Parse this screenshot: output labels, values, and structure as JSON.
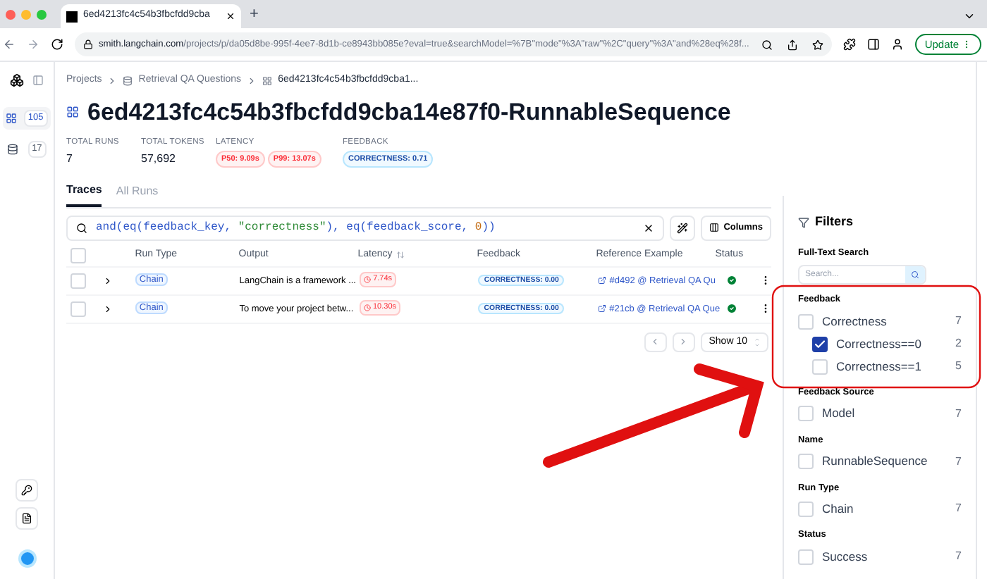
{
  "browser": {
    "tab_title": "6ed4213fc4c54b3fbcfdd9cba",
    "new_tab": "+",
    "url_host": "smith.langchain.com",
    "url_path": "/projects/p/da05d8be-995f-4ee7-8d1b-ce8943bb085e?eval=true&searchModel=%7B\"mode\"%3A\"raw\"%2C\"query\"%3A\"and%28eq%28f...",
    "update_button": "Update"
  },
  "sidebar": {
    "items": [
      {
        "kind": "grid",
        "count": "105",
        "selected": true
      },
      {
        "kind": "database",
        "count": "17",
        "selected": false
      }
    ]
  },
  "breadcrumbs": [
    "Projects",
    "Retrieval QA Questions",
    "6ed4213fc4c54b3fbcfdd9cba1..."
  ],
  "title": "6ed4213fc4c54b3fbcfdd9cba14e87f0-RunnableSequence",
  "stats": [
    {
      "label": "TOTAL RUNS",
      "kind": "value",
      "value": "7"
    },
    {
      "label": "TOTAL TOKENS",
      "kind": "value",
      "value": "57,692"
    },
    {
      "label": "LATENCY",
      "kind": "danger",
      "badges": [
        "P50: 9.09s",
        "P99: 13.07s"
      ]
    },
    {
      "label": "FEEDBACK",
      "kind": "info",
      "badges": [
        "CORRECTNESS: 0.71"
      ]
    }
  ],
  "tabs": [
    {
      "label": "Traces",
      "selected": true
    },
    {
      "label": "All Runs",
      "selected": false
    }
  ],
  "query": [
    {
      "kind": "code",
      "text": "and(eq(feedback_key, "
    },
    {
      "kind": "string",
      "text": "\"correctness\""
    },
    {
      "kind": "code",
      "text": "), eq(feedback_score, "
    },
    {
      "kind": "number",
      "text": "0"
    },
    {
      "kind": "code",
      "text": "))"
    }
  ],
  "columns_button": "Columns",
  "table": {
    "all_selected": false,
    "columns": [
      "Run Type",
      "Output",
      "Latency",
      "Feedback",
      "Reference Example",
      "Status"
    ],
    "rows": [
      {
        "selected": false,
        "run_type": "Chain",
        "output": "LangChain is a framework ...",
        "latency": "7.74s",
        "feedback": "CORRECTNESS: 0.00",
        "reference": "#d492 @ Retrieval QA Qu",
        "success": true
      },
      {
        "selected": false,
        "run_type": "Chain",
        "output": "To move your project betw...",
        "latency": "10.30s",
        "feedback": "CORRECTNESS: 0.00",
        "reference": "#21cb @ Retrieval QA Que",
        "success": true
      }
    ]
  },
  "pagination": {
    "page_size": "Show 10"
  },
  "filters": {
    "title": "Filters",
    "search_label": "Full-Text Search",
    "search_placeholder": "Search...",
    "groups": [
      {
        "title": "Feedback",
        "options": [
          {
            "label": "Correctness",
            "count": "7",
            "checked": false,
            "children": [
              {
                "label": "Correctness==0",
                "count": "2",
                "checked": true
              },
              {
                "label": "Correctness==1",
                "count": "5",
                "checked": false
              }
            ]
          }
        ]
      },
      {
        "title": "Feedback Source",
        "options": [
          {
            "label": "Model",
            "count": "7",
            "checked": false
          }
        ]
      },
      {
        "title": "Name",
        "options": [
          {
            "label": "RunnableSequence",
            "count": "7",
            "checked": false
          }
        ]
      },
      {
        "title": "Run Type",
        "options": [
          {
            "label": "Chain",
            "count": "7",
            "checked": false
          }
        ]
      },
      {
        "title": "Status",
        "options": [
          {
            "label": "Success",
            "count": "7",
            "checked": false
          }
        ]
      }
    ]
  }
}
